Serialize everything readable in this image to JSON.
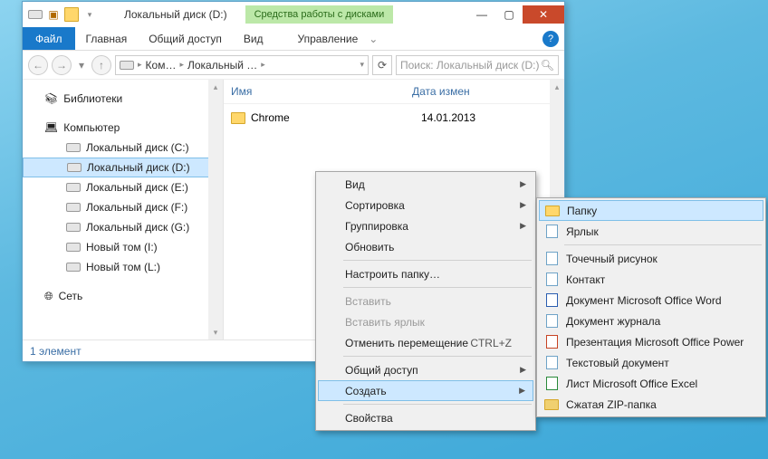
{
  "title": "Локальный диск (D:)",
  "context_tab": "Средства работы с дисками",
  "tabs": {
    "file": "Файл",
    "home": "Главная",
    "share": "Общий доступ",
    "view": "Вид",
    "manage": "Управление"
  },
  "address": {
    "crumb1": "Ком…",
    "crumb2": "Локальный …"
  },
  "search_placeholder": "Поиск: Локальный диск (D:)",
  "nav": {
    "libraries": "Библиотеки",
    "computer": "Компьютер",
    "drives": [
      "Локальный диск (C:)",
      "Локальный диск (D:)",
      "Локальный диск (E:)",
      "Локальный диск (F:)",
      "Локальный диск (G:)",
      "Новый том (I:)",
      "Новый том (L:)"
    ],
    "network": "Сеть"
  },
  "cols": {
    "name": "Имя",
    "date": "Дата измен"
  },
  "rows": [
    {
      "name": "Chrome",
      "date": "14.01.2013"
    }
  ],
  "status": "1 элемент",
  "ctx1": {
    "view": "Вид",
    "sort": "Сортировка",
    "group": "Группировка",
    "refresh": "Обновить",
    "customize": "Настроить папку…",
    "paste": "Вставить",
    "paste_shortcut": "Вставить ярлык",
    "undo_move": "Отменить перемещение",
    "undo_sc": "CTRL+Z",
    "share": "Общий доступ",
    "new": "Создать",
    "properties": "Свойства"
  },
  "ctx2": {
    "folder": "Папку",
    "shortcut": "Ярлык",
    "bitmap": "Точечный рисунок",
    "contact": "Контакт",
    "word": "Документ Microsoft Office Word",
    "journal": "Документ журнала",
    "ppt": "Презентация Microsoft Office Power",
    "txt": "Текстовый документ",
    "xls": "Лист Microsoft Office Excel",
    "zip": "Сжатая ZIP-папка"
  }
}
